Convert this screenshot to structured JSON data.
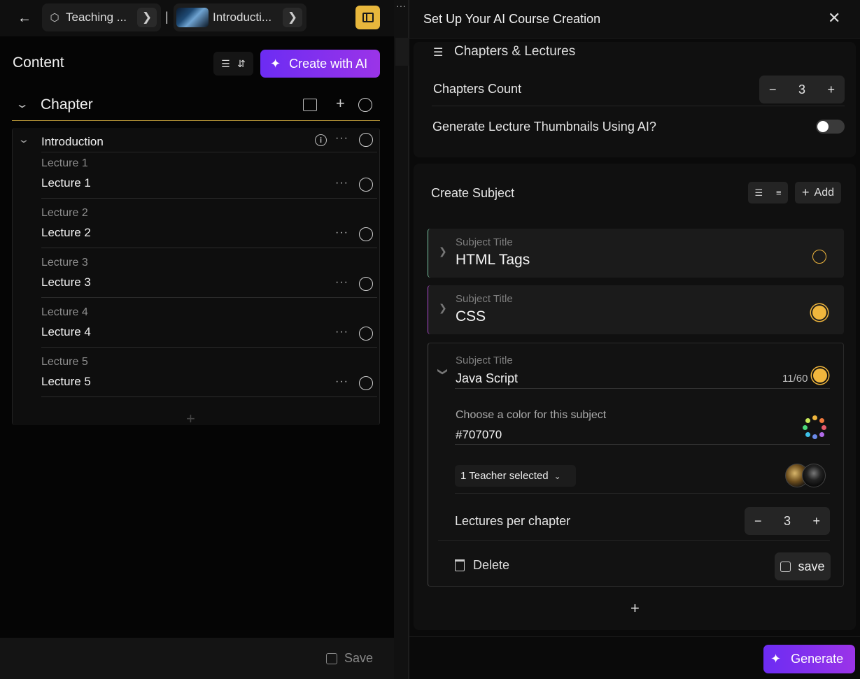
{
  "topbar": {
    "crumb1": "Teaching ...",
    "crumb2": "Introducti...",
    "separator": "|"
  },
  "content": {
    "title": "Content",
    "create_ai_label": "Create with AI",
    "chapter_title": "Chapter",
    "intro_title": "Introduction",
    "lectures": [
      {
        "placeholder": "Lecture 1",
        "title": "Lecture 1"
      },
      {
        "placeholder": "Lecture 2",
        "title": "Lecture 2"
      },
      {
        "placeholder": "Lecture 3",
        "title": "Lecture 3"
      },
      {
        "placeholder": "Lecture 4",
        "title": "Lecture 4"
      },
      {
        "placeholder": "Lecture 5",
        "title": "Lecture 5"
      }
    ],
    "save_label": "Save"
  },
  "modal": {
    "title": "Set Up Your AI Course Creation",
    "section_title": "Chapters & Lectures",
    "chapters_count_label": "Chapters Count",
    "chapters_count": "3",
    "thumbnails_label": "Generate Lecture Thumbnails Using AI?",
    "thumbnails_enabled": false,
    "create_subject_title": "Create Subject",
    "add_label": "Add",
    "subject_title_label": "Subject Title",
    "subjects": [
      {
        "title": "HTML Tags",
        "status_color": "#f0b63d"
      },
      {
        "title": "CSS",
        "status_color": "#f0b63d"
      },
      {
        "title": "Java Script",
        "status_color": "#f0b63d"
      }
    ],
    "char_counter": "11/60",
    "color_label": "Choose a color for this subject",
    "color_value": "#707070",
    "teacher_select": "1 Teacher selected",
    "lectures_per_chapter_label": "Lectures per chapter",
    "lectures_per_chapter": "3",
    "delete_label": "Delete",
    "save_label": "save",
    "generate_label": "Generate"
  },
  "colors": {
    "accent_yellow": "#e8b73c",
    "ai_gradient_start": "#6c2cf3",
    "ai_gradient_end": "#9b34e8",
    "subject_dot": "#f0b63d"
  }
}
